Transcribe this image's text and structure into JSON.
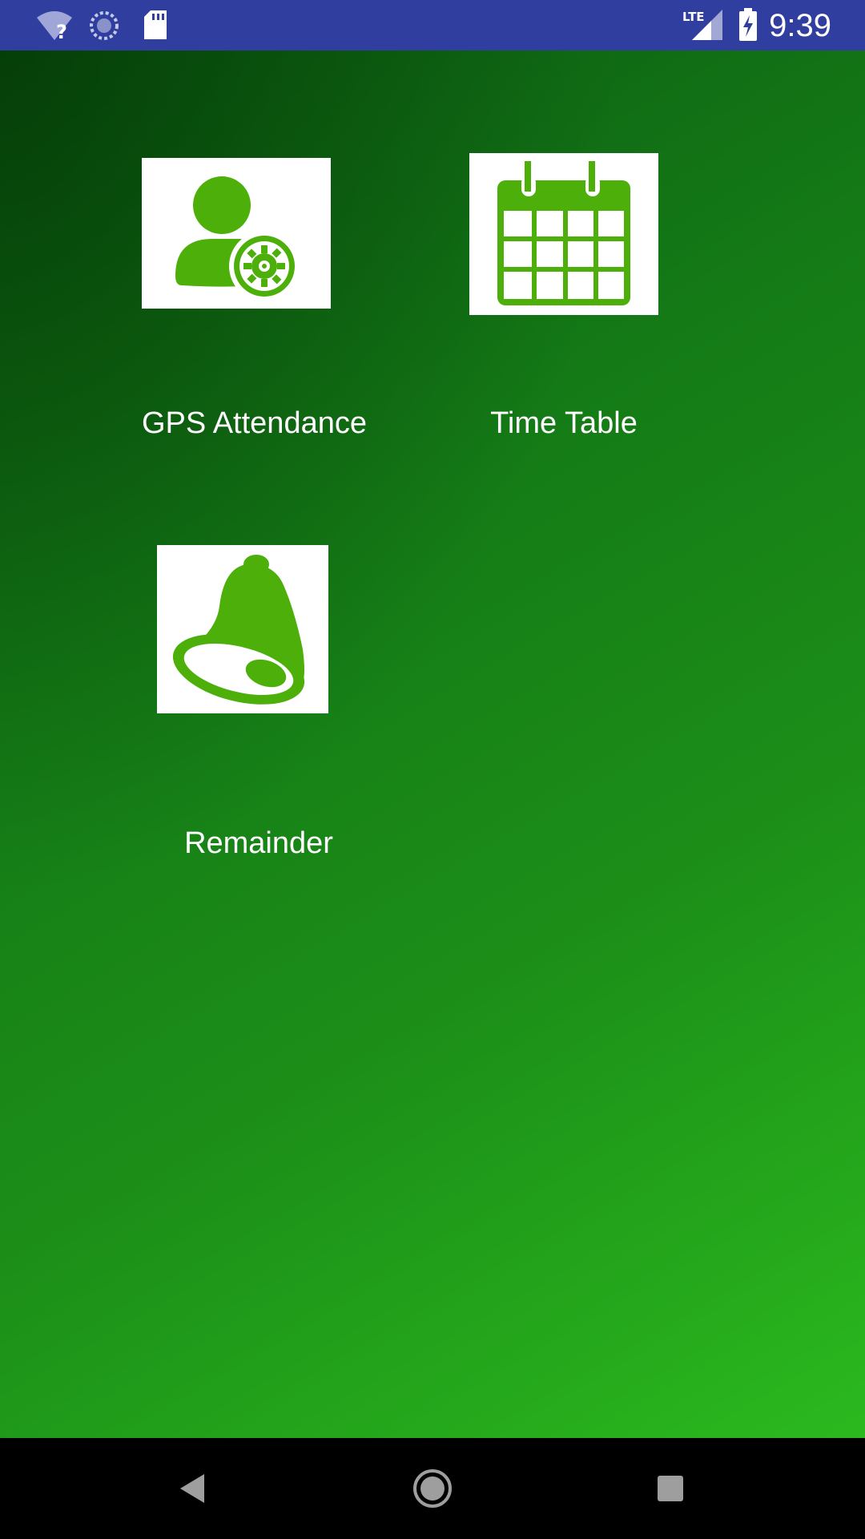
{
  "status_bar": {
    "time": "9:39",
    "network": "LTE",
    "icons": [
      "wifi-question-icon",
      "sync-icon",
      "sd-card-icon",
      "lte-signal-icon",
      "battery-charging-icon"
    ]
  },
  "tiles": [
    {
      "label": "GPS Attendance",
      "icon": "user-settings-icon"
    },
    {
      "label": "Time Table",
      "icon": "calendar-icon"
    },
    {
      "label": "Remainder",
      "icon": "bell-icon"
    }
  ],
  "colors": {
    "status_bar": "#303f9f",
    "icon_green": "#4caf0a",
    "background_dark": "#0b5a12",
    "background_light": "#2bb91e",
    "nav_bar": "#000000"
  },
  "nav_bar": {
    "icons": [
      "back-icon",
      "home-icon",
      "recents-icon"
    ]
  }
}
